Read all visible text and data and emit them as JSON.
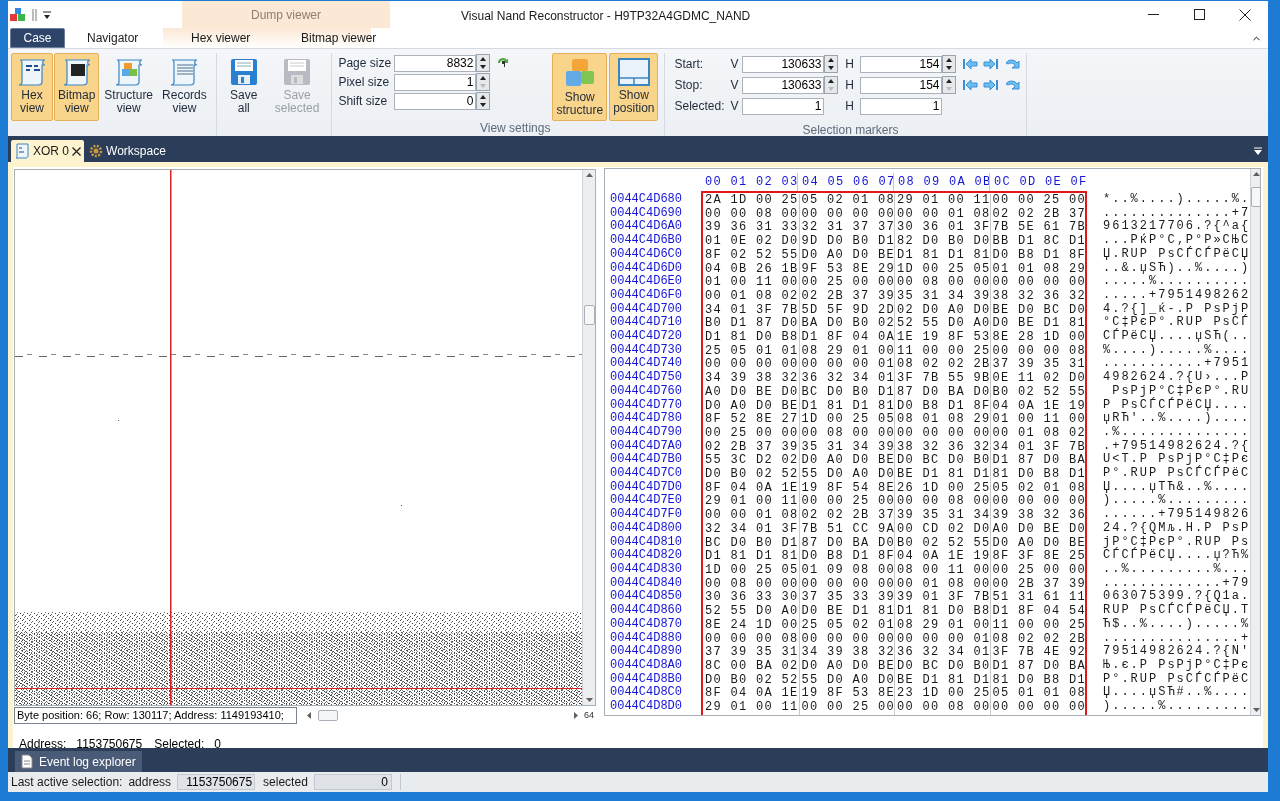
{
  "window": {
    "title": "Visual Nand Reconstructor - H9TP32A4GDMC_NAND",
    "context_group": "Dump viewer"
  },
  "ribbon_tabs": [
    {
      "label": "Case",
      "kind": "application"
    },
    {
      "label": "Navigator",
      "kind": "tab"
    },
    {
      "label": "Hex viewer",
      "kind": "tab"
    },
    {
      "label": "Bitmap viewer",
      "kind": "tab"
    }
  ],
  "view_buttons": [
    {
      "label": "Hex view",
      "kind": "hex",
      "selected": true
    },
    {
      "label": "Bitmap view",
      "kind": "bitmap",
      "selected": true
    },
    {
      "label": "Structure view",
      "kind": "structure",
      "selected": false
    },
    {
      "label": "Records view",
      "kind": "records",
      "selected": false
    }
  ],
  "save_buttons": [
    {
      "label": "Save all",
      "disabled": false
    },
    {
      "label": "Save selected",
      "disabled": true
    }
  ],
  "view_settings": {
    "label": "View settings",
    "fields": [
      {
        "label": "Page size",
        "value": "8832",
        "down_disabled": false
      },
      {
        "label": "Pixel size",
        "value": "1",
        "down_disabled": true
      },
      {
        "label": "Shift size",
        "value": "0",
        "down_disabled": false
      }
    ]
  },
  "show_buttons": [
    {
      "label": "Show structure",
      "kind": "structure",
      "selected": true
    },
    {
      "label": "Show position",
      "kind": "position",
      "selected": true
    }
  ],
  "selection_markers": {
    "label": "Selection markers",
    "rows": [
      {
        "label": "Start:",
        "v_label": "V",
        "v": "130633",
        "h_label": "H",
        "h": "154",
        "kind": "spin",
        "down_disabled": false
      },
      {
        "label": "Stop:",
        "v_label": "V",
        "v": "130633",
        "h_label": "H",
        "h": "154",
        "kind": "spin",
        "down_disabled": true
      },
      {
        "label": "Selected:",
        "v_label": "V",
        "v": "1",
        "h_label": "H",
        "h": "1",
        "kind": "plain"
      }
    ]
  },
  "document_tabs": [
    {
      "label": "XOR 0",
      "kind": "hex",
      "selected": true,
      "closable": true
    },
    {
      "label": "Workspace",
      "kind": "workspace",
      "selected": false,
      "closable": false
    }
  ],
  "bitmap_view": {
    "status": "Byte position: 66; Row: 130117; Address: 1149193410;",
    "scroll_label": "64"
  },
  "info": {
    "address_label": "Address:",
    "address": "1153750675",
    "selected_label": "Selected:",
    "selected_value": "0"
  },
  "hex_view": {
    "column_headers": [
      "00 01 02 03",
      "04 05 06 07",
      "08 09 0A 0B",
      "0C 0D 0E 0F"
    ],
    "rows": [
      {
        "address": "0044C4D680",
        "groups": [
          "2A 1D 00 25",
          "05 02 01 08",
          "29 01 00 11",
          "00 00 25 00"
        ],
        "ascii": "*..%....).....%."
      },
      {
        "address": "0044C4D690",
        "groups": [
          "00 00 08 00",
          "00 00 00 00",
          "00 00 01 08",
          "02 02 2B 37"
        ],
        "ascii": "..............+7"
      },
      {
        "address": "0044C4D6A0",
        "groups": [
          "39 36 31 33",
          "32 31 37 37",
          "30 36 01 3F",
          "7B 5E 61 7B"
        ],
        "ascii": "9613217706.?{^a{"
      },
      {
        "address": "0044C4D6B0",
        "groups": [
          "01 0E 02 D0",
          "9D D0 B0 D1",
          "82 D0 B0 D0",
          "BB D1 8C D1"
        ],
        "ascii": "...PќP°C‚P°P»CЊC"
      },
      {
        "address": "0044C4D6C0",
        "groups": [
          "8F 02 52 55",
          "D0 A0 D0 BE",
          "D1 81 D1 81",
          "D0 B8 D1 8F"
        ],
        "ascii": "Џ.RUP PsCЃCЃPëCЏ"
      },
      {
        "address": "0044C4D6D0",
        "groups": [
          "04 0B 26 1B",
          "9F 53 8E 29",
          "1D 00 25 05",
          "01 01 08 29"
        ],
        "ascii": "..&.џSЋ)..%....)"
      },
      {
        "address": "0044C4D6E0",
        "groups": [
          "01 00 11 00",
          "00 25 00 00",
          "00 08 00 00",
          "00 00 00 00"
        ],
        "ascii": ".....%.........."
      },
      {
        "address": "0044C4D6F0",
        "groups": [
          "00 01 08 02",
          "02 2B 37 39",
          "35 31 34 39",
          "38 32 36 32"
        ],
        "ascii": ".....+7951498262"
      },
      {
        "address": "0044C4D700",
        "groups": [
          "34 01 3F 7B",
          "5D 5F 9D 2D",
          "02 D0 A0 D0",
          "BE D0 BC D0"
        ],
        "ascii": "4.?{]_ќ-.P PsPjP"
      },
      {
        "address": "0044C4D710",
        "groups": [
          "B0 D1 87 D0",
          "BA D0 B0 02",
          "52 55 D0 A0",
          "D0 BE D1 81"
        ],
        "ascii": "°C‡PєP°.RUP PsCЃ"
      },
      {
        "address": "0044C4D720",
        "groups": [
          "D1 81 D0 B8",
          "D1 8F 04 0A",
          "1E 19 8F 53",
          "8E 28 1D 00"
        ],
        "ascii": "CЃPëCЏ....џSЋ(.."
      },
      {
        "address": "0044C4D730",
        "groups": [
          "25 05 01 01",
          "08 29 01 00",
          "11 00 00 25",
          "00 00 00 08"
        ],
        "ascii": "%....).....%...."
      },
      {
        "address": "0044C4D740",
        "groups": [
          "00 00 00 00",
          "00 00 00 01",
          "08 02 02 2B",
          "37 39 35 31"
        ],
        "ascii": "...........+7951"
      },
      {
        "address": "0044C4D750",
        "groups": [
          "34 39 38 32",
          "36 32 34 01",
          "3F 7B 55 9B",
          "0E 11 02 D0"
        ],
        "ascii": "4982624.?{U›...P"
      },
      {
        "address": "0044C4D760",
        "groups": [
          "A0 D0 BE D0",
          "BC D0 B0 D1",
          "87 D0 BA D0",
          "B0 02 52 55"
        ],
        "ascii": " PsPjP°C‡PєP°.RU"
      },
      {
        "address": "0044C4D770",
        "groups": [
          "D0 A0 D0 BE",
          "D1 81 D1 81",
          "D0 B8 D1 8F",
          "04 0A 1E 19"
        ],
        "ascii": "P PsCЃCЃPëCЏ...."
      },
      {
        "address": "0044C4D780",
        "groups": [
          "8F 52 8E 27",
          "1D 00 25 05",
          "08 01 08 29",
          "01 00 11 00"
        ],
        "ascii": "џRЋ'..%....)...."
      },
      {
        "address": "0044C4D790",
        "groups": [
          "00 25 00 00",
          "00 08 00 00",
          "00 00 00 00",
          "00 01 08 02"
        ],
        "ascii": ".%.............."
      },
      {
        "address": "0044C4D7A0",
        "groups": [
          "02 2B 37 39",
          "35 31 34 39",
          "38 32 36 32",
          "34 01 3F 7B"
        ],
        "ascii": ".+79514982624.?{"
      },
      {
        "address": "0044C4D7B0",
        "groups": [
          "55 3C D2 02",
          "D0 A0 D0 BE",
          "D0 BC D0 B0",
          "D1 87 D0 BA"
        ],
        "ascii": "U<T.P PsPjP°C‡Pє"
      },
      {
        "address": "0044C4D7C0",
        "groups": [
          "D0 B0 02 52",
          "55 D0 A0 D0",
          "BE D1 81 D1",
          "81 D0 B8 D1"
        ],
        "ascii": "P°.RUP PsCЃCЃPëC"
      },
      {
        "address": "0044C4D7D0",
        "groups": [
          "8F 04 0A 1E",
          "19 8F 54 8E",
          "26 1D 00 25",
          "05 02 01 08"
        ],
        "ascii": "Џ....џTЋ&..%...."
      },
      {
        "address": "0044C4D7E0",
        "groups": [
          "29 01 00 11",
          "00 00 25 00",
          "00 00 08 00",
          "00 00 00 00"
        ],
        "ascii": ").....%........."
      },
      {
        "address": "0044C4D7F0",
        "groups": [
          "00 00 01 08",
          "02 02 2B 37",
          "39 35 31 34",
          "39 38 32 36"
        ],
        "ascii": "......+795149826"
      },
      {
        "address": "0044C4D800",
        "groups": [
          "32 34 01 3F",
          "7B 51 CC 9A",
          "00 CD 02 D0",
          "A0 D0 BE D0"
        ],
        "ascii": "24.?{QМљ.Н.P PsP"
      },
      {
        "address": "0044C4D810",
        "groups": [
          "BC D0 B0 D1",
          "87 D0 BA D0",
          "B0 02 52 55",
          "D0 A0 D0 BE"
        ],
        "ascii": "jP°C‡PєP°.RUP Ps"
      },
      {
        "address": "0044C4D820",
        "groups": [
          "D1 81 D1 81",
          "D0 B8 D1 8F",
          "04 0A 1E 19",
          "8F 3F 8E 25"
        ],
        "ascii": "CЃCЃPëCЏ....џ?Ћ%"
      },
      {
        "address": "0044C4D830",
        "groups": [
          "1D 00 25 05",
          "01 09 08 00",
          "08 00 11 00",
          "00 25 00 00"
        ],
        "ascii": "..%.........%..."
      },
      {
        "address": "0044C4D840",
        "groups": [
          "00 08 00 00",
          "00 00 00 00",
          "00 01 08 00",
          "00 2B 37 39"
        ],
        "ascii": ".............+79"
      },
      {
        "address": "0044C4D850",
        "groups": [
          "30 36 33 30",
          "37 35 33 39",
          "39 01 3F 7B",
          "51 31 61 11"
        ],
        "ascii": "063075399.?{Q1a."
      },
      {
        "address": "0044C4D860",
        "groups": [
          "52 55 D0 A0",
          "D0 BE D1 81",
          "D1 81 D0 B8",
          "D1 8F 04 54"
        ],
        "ascii": "RUP PsCЃCЃPëCЏ.T"
      },
      {
        "address": "0044C4D870",
        "groups": [
          "8E 24 1D 00",
          "25 05 02 01",
          "08 29 01 00",
          "11 00 00 25"
        ],
        "ascii": "Ћ$..%....).....%"
      },
      {
        "address": "0044C4D880",
        "groups": [
          "00 00 00 08",
          "00 00 00 00",
          "00 00 00 01",
          "08 02 02 2B"
        ],
        "ascii": "...............+"
      },
      {
        "address": "0044C4D890",
        "groups": [
          "37 39 35 31",
          "34 39 38 32",
          "36 32 34 01",
          "3F 7B 4E 92"
        ],
        "ascii": "79514982624.?{N'"
      },
      {
        "address": "0044C4D8A0",
        "groups": [
          "8C 00 BA 02",
          "D0 A0 D0 BE",
          "D0 BC D0 B0",
          "D1 87 D0 BA"
        ],
        "ascii": "Њ.є.P PsPjP°C‡Pє"
      },
      {
        "address": "0044C4D8B0",
        "groups": [
          "D0 B0 02 52",
          "55 D0 A0 D0",
          "BE D1 81 D1",
          "81 D0 B8 D1"
        ],
        "ascii": "P°.RUP PsCЃCЃPëC"
      },
      {
        "address": "0044C4D8C0",
        "groups": [
          "8F 04 0A 1E",
          "19 8F 53 8E",
          "23 1D 00 25",
          "05 01 01 08"
        ],
        "ascii": "Џ....џSЋ#..%...."
      },
      {
        "address": "0044C4D8D0",
        "groups": [
          "29 01 00 11",
          "00 00 25 00",
          "00 00 08 00",
          "00 00 00 00"
        ],
        "ascii": ").....%........."
      }
    ]
  },
  "bottom_tabs": [
    {
      "label": "Event log explorer"
    }
  ],
  "status_bar": {
    "label": "Last active selection:",
    "address_label": "address",
    "address": "1153750675",
    "selected_label": "selected",
    "selected_value": "0"
  }
}
